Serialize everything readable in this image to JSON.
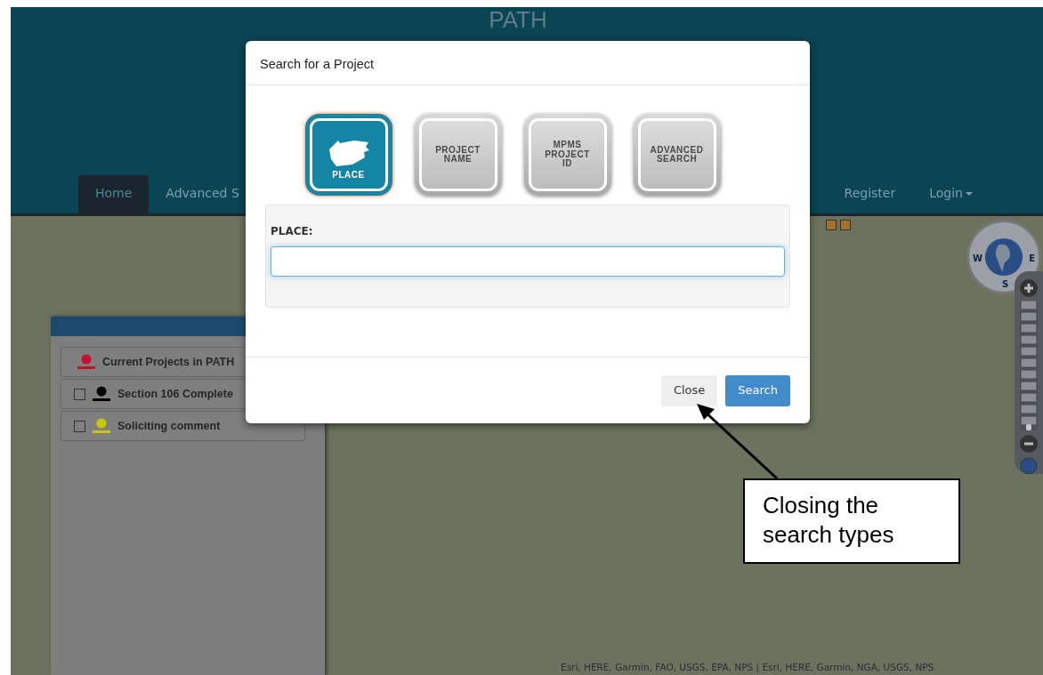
{
  "header": {
    "title": "PATH",
    "nav": [
      {
        "label": "Home",
        "selected": true
      },
      {
        "label": "Advanced S",
        "selected": false
      }
    ],
    "nav_right": [
      {
        "label": "Register",
        "kind": "link"
      },
      {
        "label": "Login",
        "kind": "dropdown"
      }
    ]
  },
  "map": {
    "compass_labels": [
      "W",
      "E",
      "S"
    ],
    "zoom_slider": {
      "level": 0.05
    },
    "attribution": "Esri, HERE, Garmin, FAO, USGS, EPA, NPS | Esri, HERE, Garmin, NGA, USGS, NPS"
  },
  "legend": {
    "items": [
      {
        "label": "Current Projects in PATH",
        "kind": "plain",
        "color": "#c8102e"
      },
      {
        "label": "Section 106 Complete",
        "kind": "checkbox",
        "checked": false,
        "color": "#000000"
      },
      {
        "label": "Soliciting comment",
        "kind": "checkbox",
        "checked": false,
        "color": "#c8c800"
      }
    ]
  },
  "modal": {
    "title": "Search for a Project",
    "search_types": [
      {
        "label": "PLACE",
        "kind": "icon",
        "selected": true
      },
      {
        "label": "PROJECT NAME",
        "kind": "text",
        "selected": false
      },
      {
        "label": "MPMS PROJECT ID",
        "kind": "text",
        "selected": false
      },
      {
        "label": "ADVANCED SEARCH",
        "kind": "text",
        "selected": false
      }
    ],
    "field": {
      "label": "PLACE:"
    },
    "buttons": [
      {
        "label": "Close",
        "kind": "secondary"
      },
      {
        "label": "Search",
        "kind": "primary"
      }
    ]
  },
  "callout": {
    "text": "Closing the search types"
  }
}
